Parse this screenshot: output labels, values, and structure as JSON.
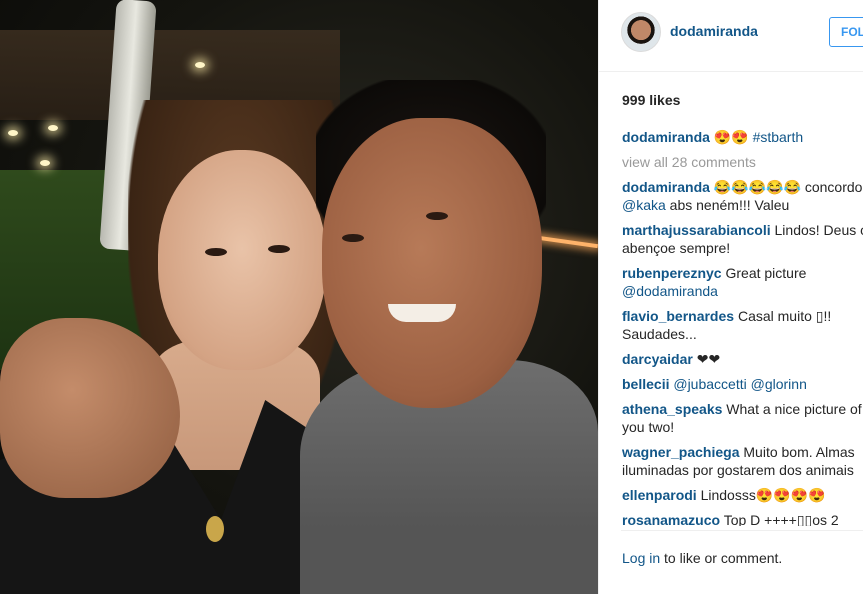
{
  "photo": {
    "icon": "selfie-photo"
  },
  "header": {
    "username": "dodamiranda",
    "follow_label": "FOLLOW"
  },
  "likes": "999 likes",
  "caption": {
    "user": "dodamiranda",
    "emoji": "😍😍",
    "tag": "#stbarth"
  },
  "view_all": "view all 28 comments",
  "comments": [
    {
      "user": "dodamiranda",
      "line1": "😂😂😂😂😂 concordo",
      "mention": "@kaka",
      "line2": " abs neném!!! Valeu"
    },
    {
      "user": "marthajussarabiancoli",
      "line1": "Lindos! Deus os",
      "line2": "abençoe sempre!"
    },
    {
      "user": "rubenpereznyc",
      "line1": "Great picture",
      "mention": "@dodamiranda"
    },
    {
      "user": "flavio_bernardes",
      "line1": "Casal muito ▯!!",
      "line2": "Saudades..."
    },
    {
      "user": "darcyaidar",
      "line1": "❤❤"
    },
    {
      "user": "bellecii",
      "mention1": "@jubaccetti",
      "mention2": "@glorinn"
    },
    {
      "user": "athena_speaks",
      "line1": "What a nice picture of",
      "line2": "you two!"
    },
    {
      "user": "wagner_pachiega",
      "line1": "Muito bom. Almas",
      "line2": "iluminadas por gostarem dos animais"
    },
    {
      "user": "ellenparodi",
      "line1": "Lindosss😍😍😍😍"
    },
    {
      "user": "rosanamazuco",
      "line1": "Top D ++++▯▯os 2"
    }
  ],
  "footer": {
    "login": "Log in",
    "rest": " to like or comment."
  }
}
